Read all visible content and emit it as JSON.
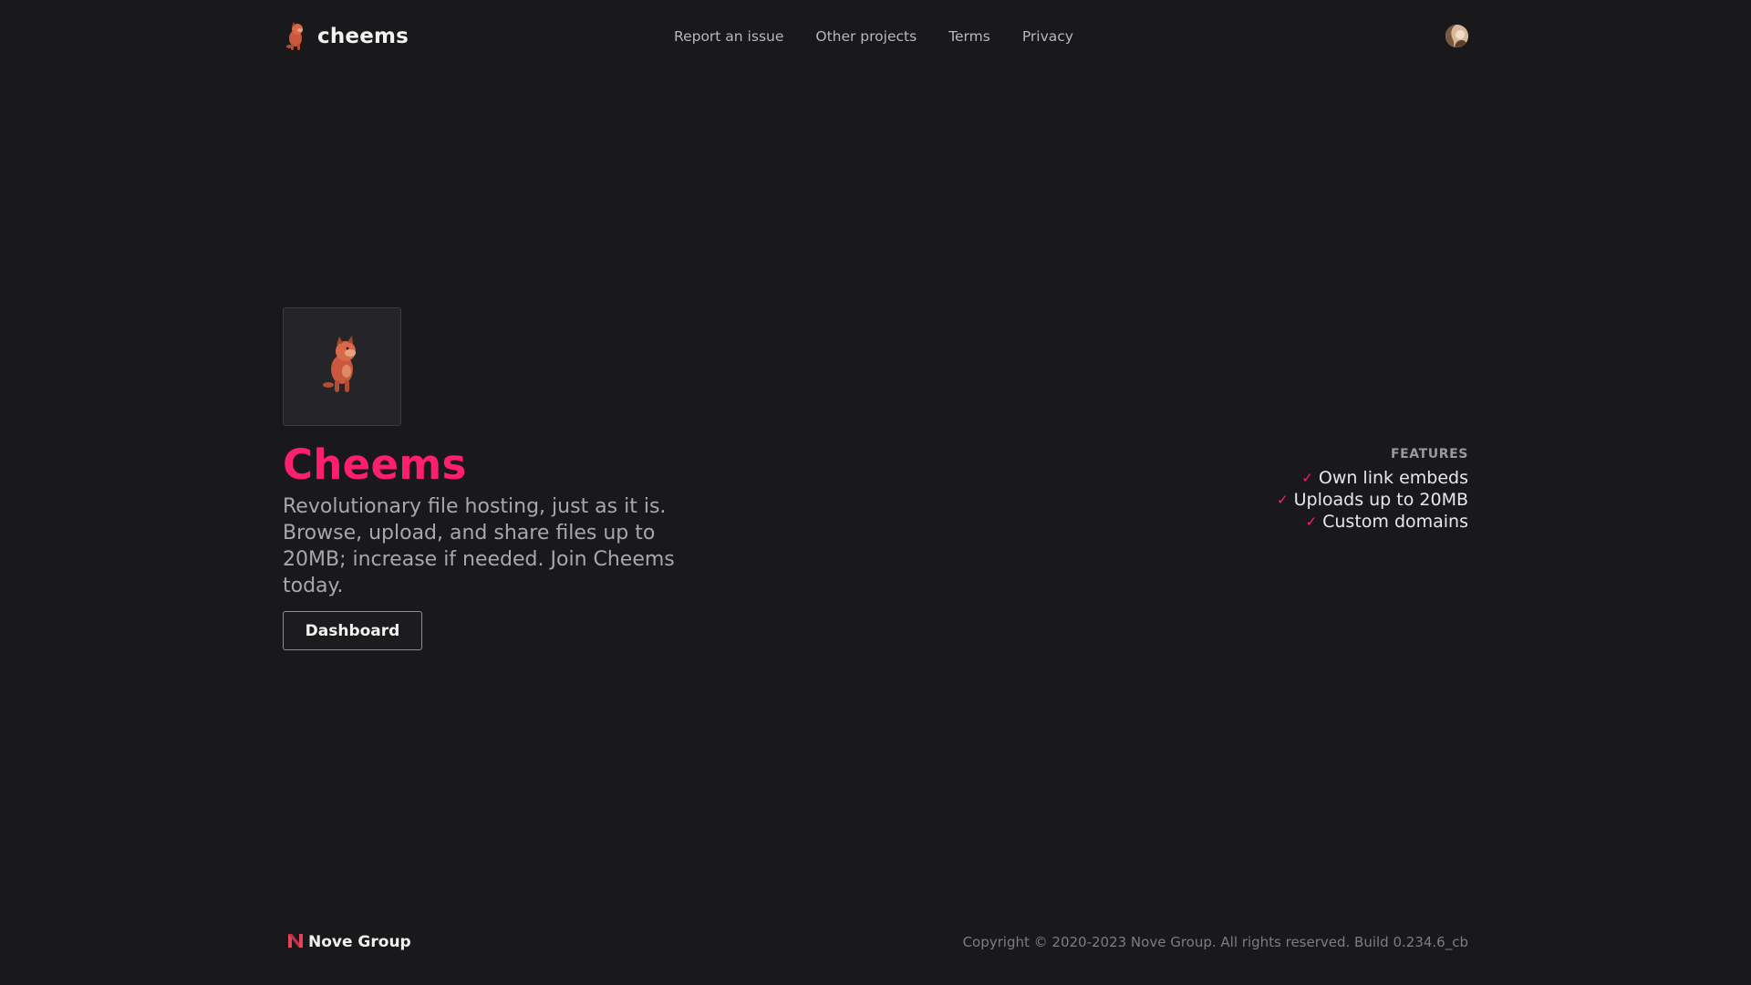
{
  "header": {
    "brand_name": "cheems",
    "brand_logo_icon": "cheems-dog-icon",
    "nav": [
      {
        "label": "Report an issue"
      },
      {
        "label": "Other projects"
      },
      {
        "label": "Terms"
      },
      {
        "label": "Privacy"
      }
    ],
    "avatar_icon": "user-avatar-icon"
  },
  "hero": {
    "image_icon": "cheems-dog-icon",
    "title": "Cheems",
    "description": "Revolutionary file hosting, just as it is. Browse, upload, and share files up to 20MB; increase if needed. Join Cheems today.",
    "dashboard_label": "Dashboard"
  },
  "features": {
    "heading": "FEATURES",
    "items": [
      {
        "label": "Own link embeds",
        "icon": "check-icon"
      },
      {
        "label": "Uploads up to 20MB",
        "icon": "check-icon"
      },
      {
        "label": "Custom domains",
        "icon": "check-icon"
      }
    ]
  },
  "footer": {
    "brand_name": "Nove Group",
    "brand_icon": "nove-logo-icon",
    "copyright": "Copyright © 2020-2023 Nove Group. All rights reserved. Build 0.234.6_cb"
  },
  "colors": {
    "background": "#19191b",
    "accent": "#ff1f6c",
    "text_primary": "#f2f2f2",
    "text_muted": "#a8a8ac"
  }
}
